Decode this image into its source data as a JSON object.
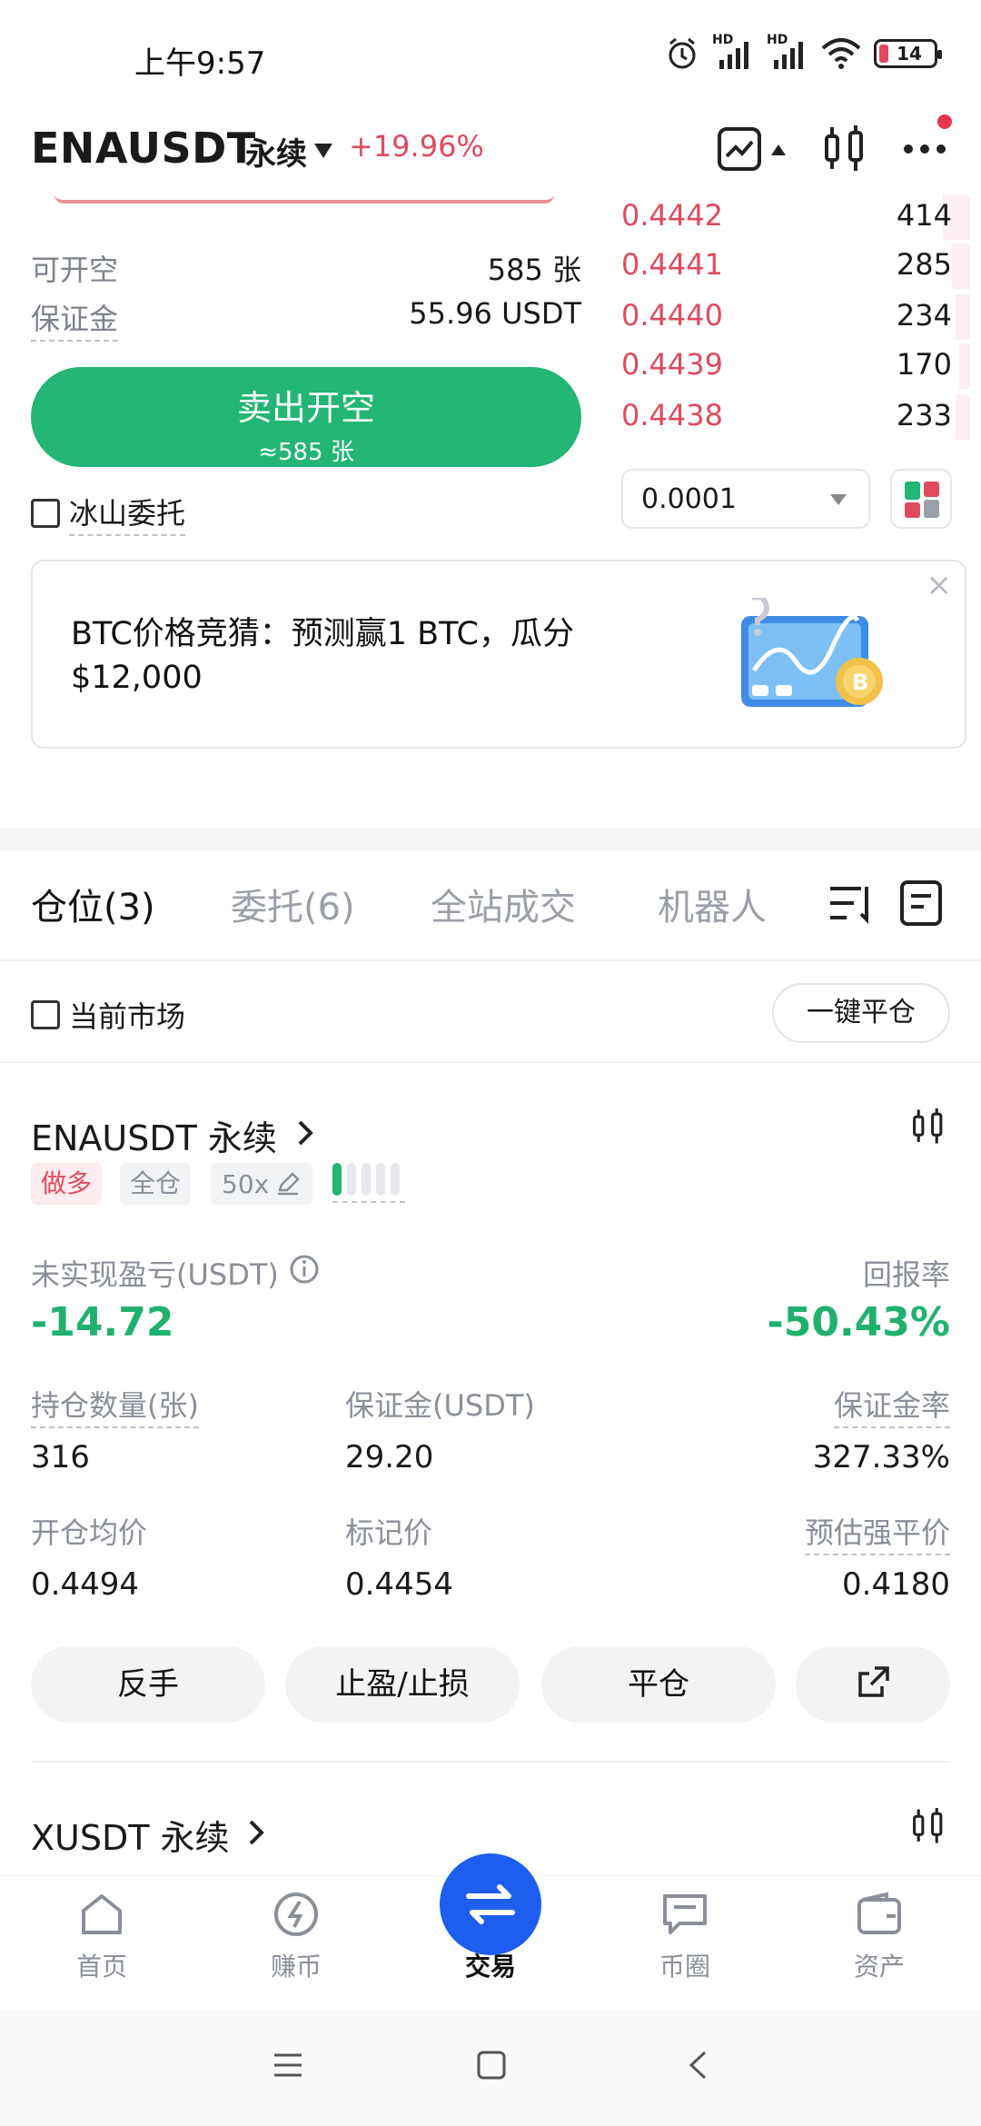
{
  "status_bar": {
    "time": "上午9:57",
    "signal1": "HD",
    "signal2": "HD",
    "battery": "14"
  },
  "header": {
    "pair": "ENAUSDT",
    "contract_type": "永续",
    "change": "+19.96%"
  },
  "order_form": {
    "can_open_label": "可开空",
    "can_open_value": "585 张",
    "margin_label": "保证金",
    "margin_value": "55.96 USDT",
    "sell_button_label": "卖出开空",
    "sell_button_sub": "≈585 张",
    "iceberg_label": "冰山委托"
  },
  "orderbook": {
    "asks": [
      {
        "price": "0.4442",
        "qty": "414",
        "depth": 0.3
      },
      {
        "price": "0.4441",
        "qty": "285",
        "depth": 0.2
      },
      {
        "price": "0.4440",
        "qty": "234",
        "depth": 0.16
      },
      {
        "price": "0.4439",
        "qty": "170",
        "depth": 0.12
      },
      {
        "price": "0.4438",
        "qty": "233",
        "depth": 0.16
      }
    ],
    "precision": "0.0001"
  },
  "banner": {
    "text_line1": "BTC价格竞猜：预测赢1 BTC，瓜分",
    "text_line2": "$12,000",
    "close": "×"
  },
  "tabs": {
    "positions": "仓位(3)",
    "orders": "委托(6)",
    "market_trades": "全站成交",
    "bots": "机器人"
  },
  "filter": {
    "current_market_label": "当前市场",
    "close_all_label": "一键平仓"
  },
  "position": {
    "title": "ENAUSDT 永续",
    "side_tag": "做多",
    "margin_mode_tag": "全仓",
    "leverage_tag": "50x",
    "leverage_level": 0.2,
    "pnl_label": "未实现盈亏(USDT)",
    "pnl_value": "-14.72",
    "roe_label": "回报率",
    "roe_value": "-50.43%",
    "qty_label": "持仓数量(张)",
    "qty_value": "316",
    "margin_label": "保证金(USDT)",
    "margin_value": "29.20",
    "margin_ratio_label": "保证金率",
    "margin_ratio_value": "327.33%",
    "entry_label": "开仓均价",
    "entry_value": "0.4494",
    "mark_label": "标记价",
    "mark_value": "0.4454",
    "liq_label": "预估强平价",
    "liq_value": "0.4180",
    "btn_reverse": "反手",
    "btn_tpsl": "止盈/止损",
    "btn_close": "平仓"
  },
  "next_position": {
    "title": "XUSDT 永续"
  },
  "bottom_nav": {
    "home": "首页",
    "earn": "赚币",
    "trade": "交易",
    "community": "币圈",
    "assets": "资产"
  },
  "colors": {
    "up_green": "#21b16e",
    "down_red": "#e04a5f",
    "accent_blue": "#1d5ef0"
  }
}
